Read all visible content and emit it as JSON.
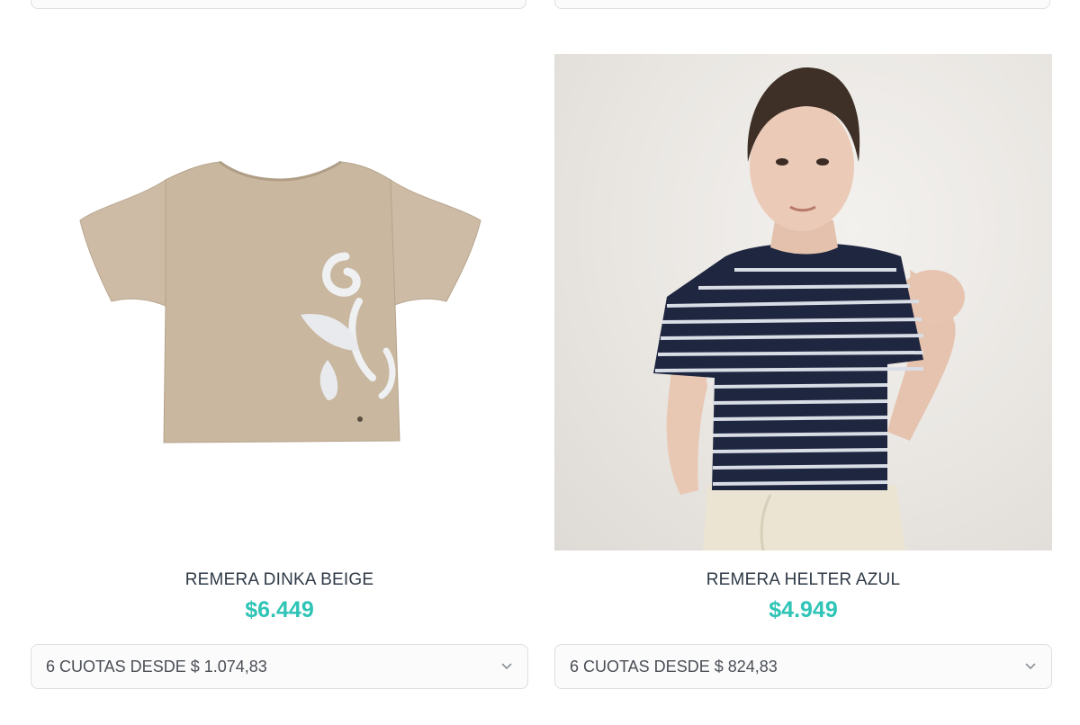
{
  "products": [
    {
      "name": "REMERA DINKA BEIGE",
      "price": "$6.449",
      "installments": "6 CUOTAS DESDE $ 1.074,83",
      "image_description_icon": "tshirt-beige-ruffle-sleeves",
      "accent": "#2ec4b6"
    },
    {
      "name": "REMERA HELTER AZUL",
      "price": "$4.949",
      "installments": "6 CUOTAS DESDE $ 824,83",
      "image_description_icon": "girl-striped-navy-tshirt",
      "accent": "#2ec4b6"
    }
  ],
  "icons": {
    "dropdown": "chevron-down-icon"
  }
}
